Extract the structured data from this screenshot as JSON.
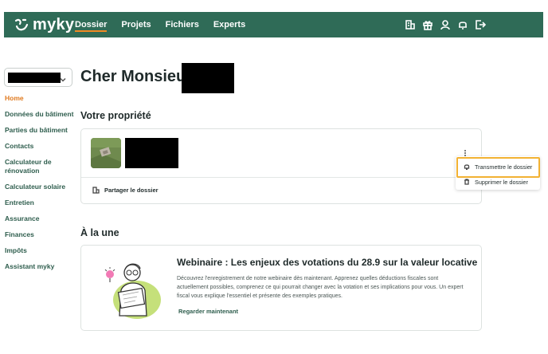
{
  "app": {
    "name": "myky"
  },
  "nav": {
    "items": [
      {
        "label": "Dossier",
        "active": true
      },
      {
        "label": "Projets",
        "active": false
      },
      {
        "label": "Fichiers",
        "active": false
      },
      {
        "label": "Experts",
        "active": false
      }
    ],
    "icons": [
      "building-icon",
      "gift-icon",
      "user-icon",
      "bell-icon",
      "logout-icon"
    ]
  },
  "sidebar": {
    "items": [
      {
        "label": "Home",
        "active": true
      },
      {
        "label": "Données du bâtiment"
      },
      {
        "label": "Parties du bâtiment"
      },
      {
        "label": "Contacts"
      },
      {
        "label": "Calculateur de rénovation"
      },
      {
        "label": "Calculateur solaire"
      },
      {
        "label": "Entretien"
      },
      {
        "label": "Assurance"
      },
      {
        "label": "Finances"
      },
      {
        "label": "Impôts"
      },
      {
        "label": "Assistant myky"
      }
    ]
  },
  "main": {
    "greeting": "Cher Monsieur",
    "property_section_title": "Votre propriété",
    "share_label": "Partager le dossier",
    "menu": {
      "transfer_label": "Transmettre le dossier",
      "delete_label": "Supprimer le dossier"
    },
    "news_section_title": "À la une",
    "news": {
      "title": "Webinaire : Les enjeux des votations du 28.9 sur la valeur locative",
      "body": "Découvrez l'enregistrement de notre webinaire dès maintenant. Apprenez quelles déductions fiscales sont actuellement possibles, comprenez ce qui pourrait changer avec la votation et ses implications pour vous. Un expert fiscal vous explique l'essentiel et présente des exemples pratiques.",
      "cta": "Regarder maintenant"
    }
  },
  "colors": {
    "topbar": "#2f6b57",
    "accent": "#f08a24",
    "highlight": "#f2b233",
    "link": "#2f5e4e"
  }
}
